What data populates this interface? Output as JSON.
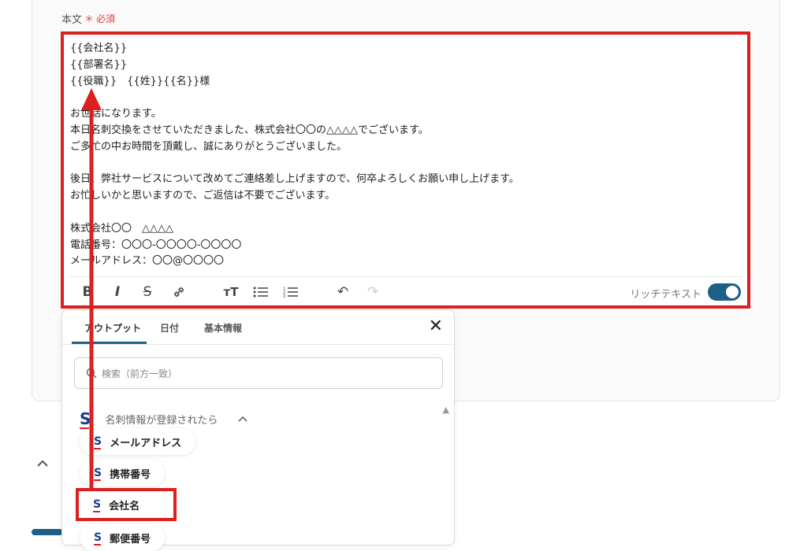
{
  "field": {
    "label": "本文",
    "required_mark": "＊",
    "required_text": "必須"
  },
  "editor": {
    "body": "{{会社名}}\n{{部署名}}\n{{役職}}　{{姓}}{{名}}様\n\nお世話になります。\n本日名刺交換をさせていただきました、株式会社〇〇の△△△△でございます。\nご多忙の中お時間を頂戴し、誠にありがとうございました。\n\n後日、弊社サービスについて改めてご連絡差し上げますので、何卒よろしくお願い申し上げます。\nお忙しいかと思いますので、ご返信は不要でございます。\n\n株式会社〇〇　△△△△\n電話番号：〇〇〇-〇〇〇〇-〇〇〇〇\nメールアドレス：〇〇@〇〇〇〇"
  },
  "toolbar": {
    "bold": "B",
    "italic": "I",
    "strike": "S",
    "link": "🔗",
    "heading": "ᴛT",
    "bullet_list": "☰",
    "ordered_list": "☷",
    "undo": "↶",
    "redo": "↷",
    "rich_text_label": "リッチテキスト",
    "rich_text_on": true
  },
  "popup": {
    "tabs": [
      "アウトプット",
      "日付",
      "基本情報"
    ],
    "active_tab": "アウトプット",
    "close": "✕",
    "search_placeholder": "検索（前方一致）",
    "section_title": "名刺情報が登録されたら",
    "items": [
      "メールアドレス",
      "携帯番号",
      "会社名",
      "郵便番号"
    ]
  },
  "colors": {
    "highlight": "#dd1f1f",
    "accent": "#1e5f86",
    "brand": "#1b3d8f"
  }
}
